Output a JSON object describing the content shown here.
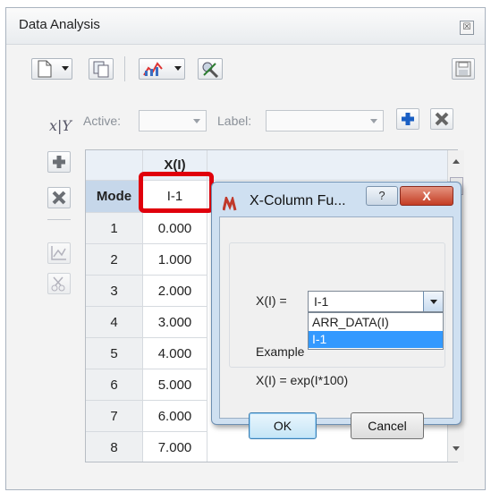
{
  "panel": {
    "title": "Data Analysis",
    "close_glyph": "☒"
  },
  "variable_bar": {
    "icon_text": "x|Y",
    "active_label": "Active:",
    "active_value": "",
    "label_label": "Label:",
    "label_value": ""
  },
  "grid": {
    "header_row": [
      "",
      "X(I)"
    ],
    "mode_row": [
      "Mode",
      "I-1"
    ],
    "rows": [
      {
        "n": "1",
        "x": "0.000"
      },
      {
        "n": "2",
        "x": "1.000"
      },
      {
        "n": "3",
        "x": "2.000"
      },
      {
        "n": "4",
        "x": "3.000"
      },
      {
        "n": "5",
        "x": "4.000"
      },
      {
        "n": "6",
        "x": "5.000"
      },
      {
        "n": "7",
        "x": "6.000"
      },
      {
        "n": "8",
        "x": "7.000"
      }
    ]
  },
  "dialog": {
    "title": "X-Column Fu...",
    "help_label": "?",
    "close_label": "X",
    "field_label": "X(I) =",
    "field_value": "I-1",
    "options": [
      "ARR_DATA(I)",
      "I-1"
    ],
    "selected_option": "I-1",
    "example_label": "Example",
    "example_text": "X(I) = exp(I*100)",
    "ok_label": "OK",
    "cancel_label": "Cancel"
  },
  "colors": {
    "highlight": "#e0000c",
    "selection": "#3399ff",
    "dialog_frame": "#cfe0f1",
    "close_red": "#c43d24"
  }
}
